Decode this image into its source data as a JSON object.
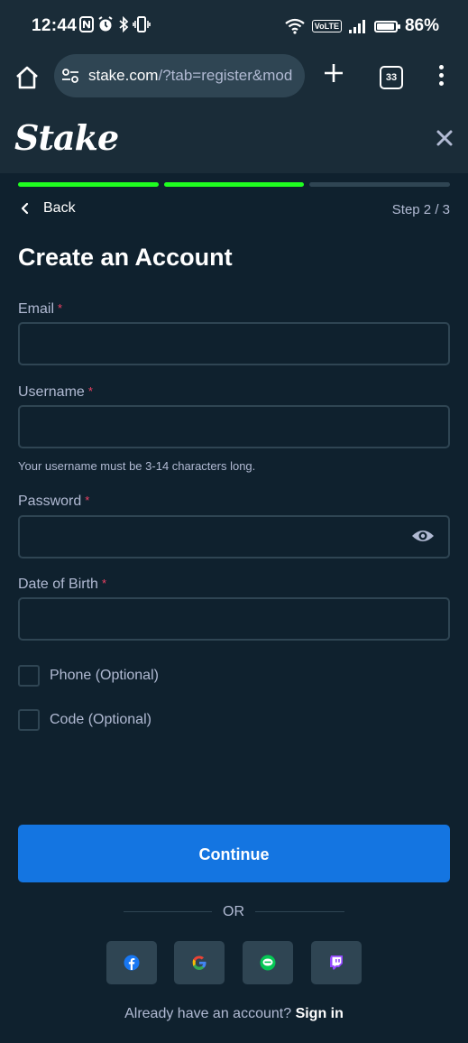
{
  "status_bar": {
    "time": "12:44",
    "left_icons": [
      "nfc-icon",
      "alarm-icon",
      "bluetooth-icon",
      "vibrate-icon"
    ],
    "volte": "VoLTE",
    "battery": "86%",
    "battery_level": 0.86
  },
  "browser": {
    "url_host": "stake.com",
    "url_path": "/?tab=register&mod",
    "tab_count": "33"
  },
  "header": {
    "logo": "Stake"
  },
  "progress": {
    "segments": 3,
    "completed": 2,
    "color_done": "#1fff20",
    "color_todo": "#2f4553"
  },
  "nav": {
    "back_label": "Back",
    "step_label": "Step 2 / 3"
  },
  "form": {
    "title": "Create an Account",
    "email_label": "Email",
    "username_label": "Username",
    "username_hint": "Your username must be 3-14 characters long.",
    "password_label": "Password",
    "dob_label": "Date of Birth",
    "required_mark": "*",
    "email_value": "",
    "username_value": "",
    "password_value": "",
    "dob_value": "",
    "phone_optional_label": "Phone (Optional)",
    "code_optional_label": "Code (Optional)"
  },
  "actions": {
    "continue_label": "Continue",
    "or_label": "OR",
    "social": [
      {
        "name": "facebook-icon",
        "color": "#1877f2"
      },
      {
        "name": "google-icon",
        "color": "#4285f4"
      },
      {
        "name": "line-icon",
        "color": "#06c755"
      },
      {
        "name": "twitch-icon",
        "color": "#9146ff"
      }
    ],
    "signin_prompt": "Already have an account?",
    "signin_link": "Sign in"
  },
  "colors": {
    "background": "#0f212e",
    "header": "#1a2c38",
    "input_border": "#2f4553",
    "accent_blue": "#1475e1",
    "required_red": "#ed4163"
  }
}
